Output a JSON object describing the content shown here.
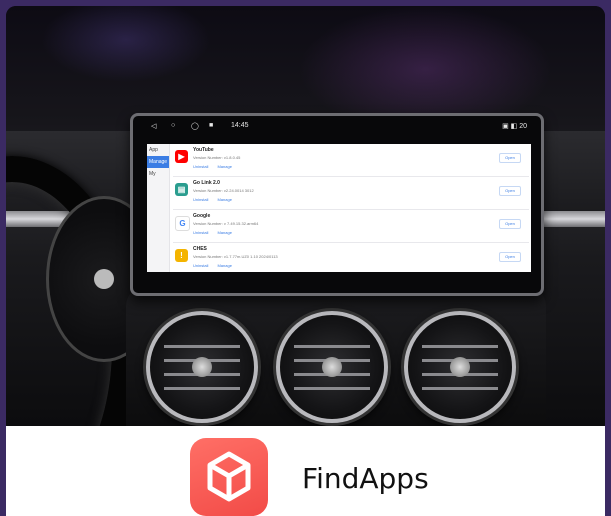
{
  "screen": {
    "status_bar": {
      "clock": "14:45",
      "nav_buttons": [
        "back-icon",
        "home-icon",
        "recent-icon",
        "square-icon"
      ],
      "status_icons": "▣ ◧ 20"
    },
    "side_tabs": [
      {
        "label": "App",
        "active": false
      },
      {
        "label": "Manage",
        "active": true
      },
      {
        "label": "My",
        "active": false
      }
    ],
    "apps": [
      {
        "name": "YouTube",
        "version": "Version Number: v1.8.0.45",
        "icon": "youtube-icon",
        "icon_glyph": "▶",
        "icon_color": "#ff0000",
        "actions": [
          "Uninstall",
          "Manage"
        ],
        "open_label": "Open"
      },
      {
        "name": "Go Link 2.0",
        "version": "Version Number: v2.24.0014 3012",
        "icon": "golink-icon",
        "icon_glyph": "▤",
        "icon_color": "#2a9d8f",
        "actions": [
          "Uninstall",
          "Manage"
        ],
        "open_label": "Open"
      },
      {
        "name": "Google",
        "version": "Version Number: v 7.49.15.32.arm64",
        "icon": "google-icon",
        "icon_glyph": "G",
        "icon_color": "#4285f4",
        "actions": [
          "Uninstall",
          "Manage"
        ],
        "open_label": "Open"
      },
      {
        "name": "CHES",
        "version": "Version Number: v1.7.77m.UZ0 1.10 2024/0113",
        "icon": "ches-icon",
        "icon_glyph": "!",
        "icon_color": "#f4b400",
        "actions": [
          "Uninstall",
          "Manage"
        ],
        "open_label": "Open"
      }
    ]
  },
  "footer": {
    "app_name": "FindApps",
    "logo_icon": "findapps-cube-icon",
    "logo_color": "#f24b47"
  }
}
